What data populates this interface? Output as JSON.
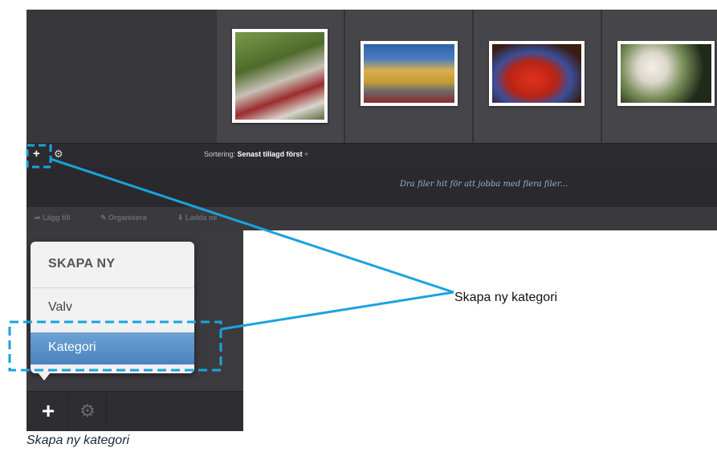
{
  "app": {
    "sort_label": "Sortering:",
    "sort_value": "Senast tillagd först",
    "sort_arrow": "÷",
    "drop_hint": "Dra filer hit för att jobba med flera filer...",
    "actions": [
      "Lägg till",
      "Organisera",
      "Ladda ne"
    ],
    "photos": [
      {
        "name": "saw-photo",
        "colors": [
          "#5d7a3a",
          "#c9c3bb",
          "#8c2a2a"
        ]
      },
      {
        "name": "garage-photo",
        "colors": [
          "#2f63a8",
          "#d9b04a",
          "#6b6b6b"
        ]
      },
      {
        "name": "lobster-photo",
        "colors": [
          "#3a1c14",
          "#d1301c",
          "#3b4f9a"
        ]
      },
      {
        "name": "blossom-photo",
        "colors": [
          "#1f2a18",
          "#f3f0ea",
          "#7a8f5a"
        ]
      }
    ]
  },
  "menu": {
    "heading": "SKAPA NY",
    "items": [
      "Valv",
      "Kategori"
    ]
  },
  "annotation": {
    "label": "Skapa ny kategori",
    "color": "#1aa3df"
  },
  "caption": "Skapa ny kategori"
}
